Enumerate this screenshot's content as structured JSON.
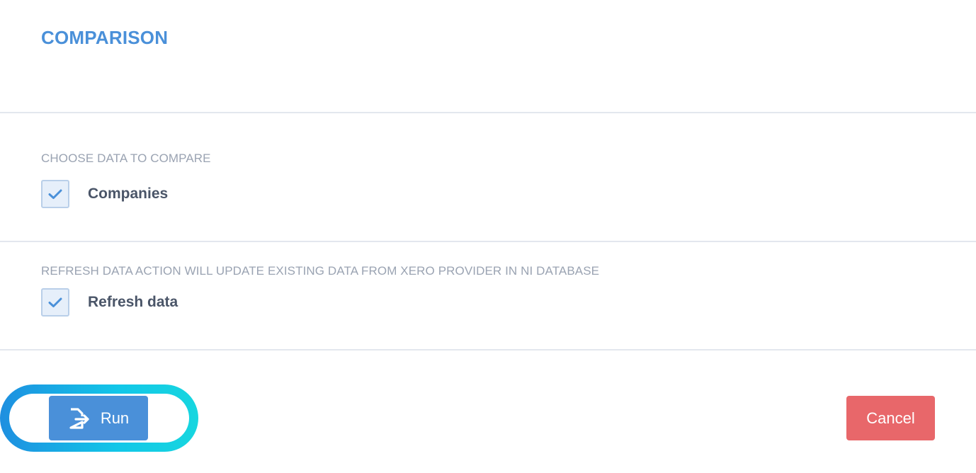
{
  "header": {
    "title": "COMPARISON"
  },
  "compare_section": {
    "label": "CHOOSE DATA TO COMPARE",
    "option": {
      "label": "Companies",
      "checked": true
    }
  },
  "refresh_section": {
    "label": "REFRESH DATA ACTION WILL UPDATE EXISTING DATA FROM XERO PROVIDER IN NI DATABASE",
    "option": {
      "label": "Refresh data",
      "checked": true
    }
  },
  "actions": {
    "run_label": "Run",
    "run_icon": "export-icon",
    "cancel_label": "Cancel"
  },
  "colors": {
    "accent": "#4a90d9",
    "cancel": "#e8676a",
    "highlight_ring": "#12c7e8"
  }
}
